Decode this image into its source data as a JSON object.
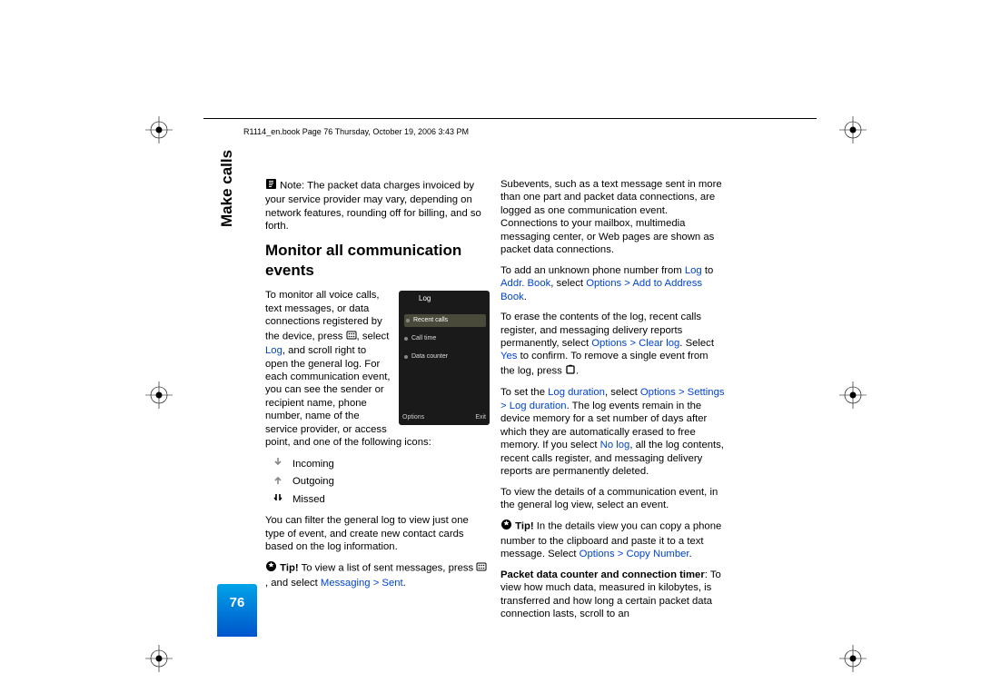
{
  "header": "R1114_en.book  Page 76  Thursday, October 19, 2006  3:43 PM",
  "sidebar": "Make calls",
  "page_number": "76",
  "col1": {
    "note": "Note: The packet data charges invoiced by your service provider may vary, depending on network features, rounding off for billing, and so forth.",
    "h2": "Monitor all communication events",
    "p1a": "To monitor all voice calls, text messages, or data connections registered by the device, press ",
    "p1b": ", select ",
    "p1_log": "Log",
    "p1c": ", and scroll right to open the general log. For each communication event, you can see the sender or recipient name, phone number, name of the service provider, or access point, and one of the following icons:",
    "icons": {
      "incoming": "Incoming",
      "outgoing": "Outgoing",
      "missed": "Missed"
    },
    "p2": "You can filter the general log to view just one type of event, and create new contact cards based on the log information.",
    "tip1a": "Tip!",
    "tip1b": " To view a list of sent messages, press ",
    "tip1c": " , and select ",
    "tip1_link": "Messaging > Sent",
    "tip1d": "."
  },
  "col2": {
    "p1": "Subevents, such as a text message sent in more than one part and packet data connections, are logged as one communication event. Connections to your mailbox, multimedia messaging center, or Web pages are shown as packet data connections.",
    "p2a": "To add an unknown phone number from ",
    "p2_log": "Log",
    "p2b": " to ",
    "p2_addr": "Addr. Book",
    "p2c": ", select ",
    "p2_opt": "Options > Add to Address Book",
    "p2d": ".",
    "p3a": "To erase the contents of the log, recent calls register, and messaging delivery reports permanently, select ",
    "p3_opt": "Options > Clear log",
    "p3b": ". Select ",
    "p3_yes": "Yes",
    "p3c": " to confirm. To remove a single event from the log, press ",
    "p3d": ".",
    "p4a": "To set the ",
    "p4_ld": "Log duration",
    "p4b": ", select ",
    "p4_opt": "Options > Settings > Log duration",
    "p4c": ". The log events remain in the device memory for a set number of days after which they are automatically erased to free memory. If you select ",
    "p4_nolog": "No log",
    "p4d": ", all the log contents, recent calls register, and messaging delivery reports are permanently deleted.",
    "p5": "To view the details of a communication event, in the general log view, select an event.",
    "tip2a": "Tip!",
    "tip2b": " In the details view you can copy a phone number to the clipboard and paste it to a text message. Select ",
    "tip2_link": "Options > Copy Number",
    "tip2c": ".",
    "p6a": "Packet data counter and connection timer",
    "p6b": ": To view how much data, measured in kilobytes, is transferred and how long a certain packet data connection lasts, scroll to an"
  },
  "figure": {
    "title": "Log",
    "row1": "Recent calls",
    "row2": "Call time",
    "row3": "Data counter",
    "sk_left": "Options",
    "sk_right": "Exit"
  }
}
